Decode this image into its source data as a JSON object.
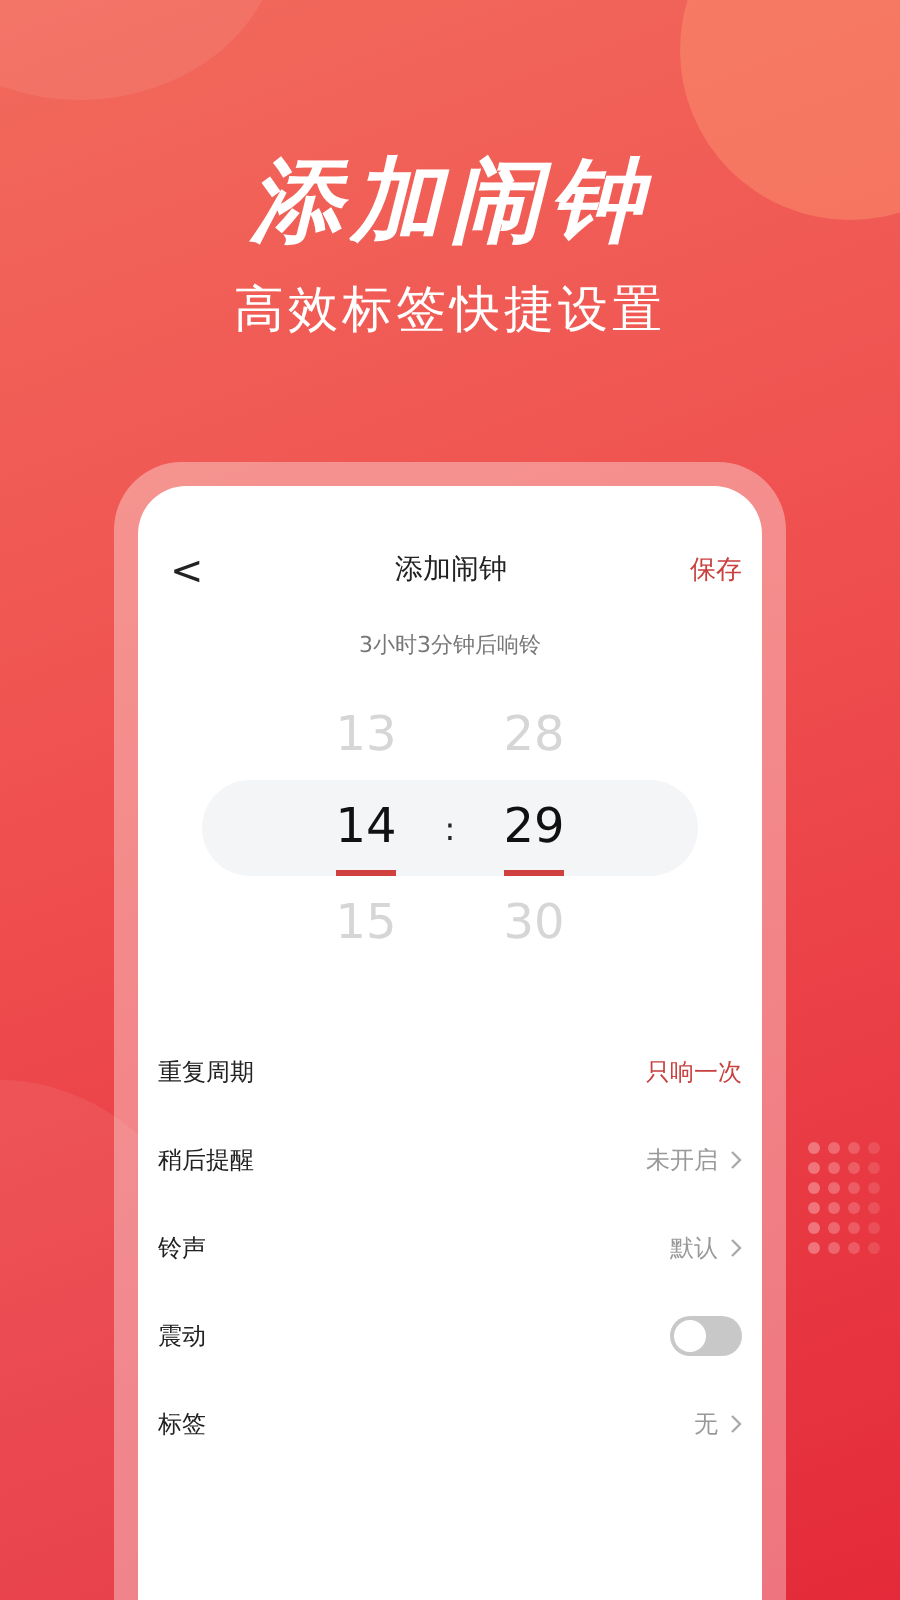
{
  "headline": "添加闹钟",
  "tagline": "高效标签快捷设置",
  "screen": {
    "back": "<",
    "title": "添加闹钟",
    "save": "保存",
    "countdown": "3小时3分钟后响铃",
    "picker": {
      "separator": ":",
      "columns": [
        {
          "above": "13",
          "value": "14",
          "below": "15"
        },
        {
          "above": "28",
          "value": "29",
          "below": "30"
        }
      ]
    },
    "settings": [
      {
        "kind": "value",
        "label": "重复周期",
        "value": "只响一次"
      },
      {
        "kind": "link",
        "label": "稍后提醒",
        "value": "未开启"
      },
      {
        "kind": "link",
        "label": "铃声",
        "value": "默认"
      },
      {
        "kind": "toggle",
        "label": "震动",
        "on": false
      },
      {
        "kind": "link",
        "label": "标签",
        "value": "无"
      }
    ]
  }
}
